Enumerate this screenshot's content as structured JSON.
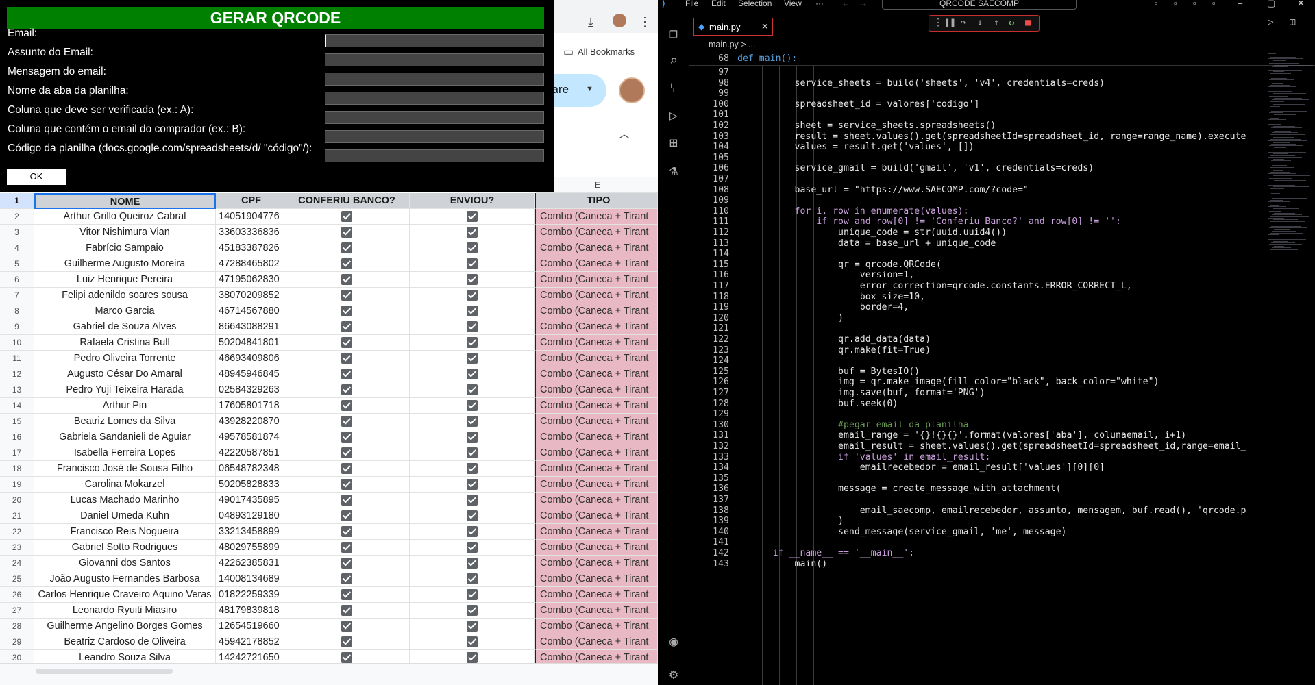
{
  "browser": {
    "bookmarks_label": "All Bookmarks",
    "share_label": "nare",
    "column_e_label": "E"
  },
  "dialog": {
    "title": "GERAR QRCODE",
    "fields": [
      {
        "label": "Email:",
        "value": ""
      },
      {
        "label": "Assunto do Email:",
        "value": ""
      },
      {
        "label": "Mensagem do email:",
        "value": ""
      },
      {
        "label": "Nome da aba da planilha:",
        "value": ""
      },
      {
        "label": "Coluna que deve ser verificada (ex.: A):",
        "value": ""
      },
      {
        "label": "Coluna que contém o email do comprador (ex.: B):",
        "value": ""
      },
      {
        "label": "Código da planilha (docs.google.com/spreadsheets/d/ \"código\"/):",
        "value": ""
      }
    ],
    "ok_label": "OK"
  },
  "sheet": {
    "headers": [
      "NOME",
      "CPF",
      "CONFERIU BANCO?",
      "ENVIOU?",
      "TIPO"
    ],
    "tipo_value": "Combo (Caneca + Tirant",
    "tipo_color": "#e8b9c4",
    "rows": [
      {
        "n": "2",
        "nome": "Arthur Grillo Queiroz Cabral",
        "cpf": "14051904776"
      },
      {
        "n": "3",
        "nome": "Vitor Nishimura Vian",
        "cpf": "33603336836"
      },
      {
        "n": "4",
        "nome": "Fabrício Sampaio",
        "cpf": "45183387826"
      },
      {
        "n": "5",
        "nome": "Guilherme Augusto Moreira",
        "cpf": "47288465802"
      },
      {
        "n": "6",
        "nome": "Luiz Henrique Pereira",
        "cpf": "47195062830"
      },
      {
        "n": "7",
        "nome": "Felipi adenildo soares sousa",
        "cpf": "38070209852"
      },
      {
        "n": "8",
        "nome": "Marco Garcia",
        "cpf": "46714567880"
      },
      {
        "n": "9",
        "nome": "Gabriel de Souza Alves",
        "cpf": "86643088291"
      },
      {
        "n": "10",
        "nome": "Rafaela Cristina Bull",
        "cpf": "50204841801"
      },
      {
        "n": "11",
        "nome": "Pedro Oliveira Torrente",
        "cpf": "46693409806"
      },
      {
        "n": "12",
        "nome": "Augusto César Do Amaral",
        "cpf": "48945946845"
      },
      {
        "n": "13",
        "nome": "Pedro Yuji Teixeira Harada",
        "cpf": "02584329263"
      },
      {
        "n": "14",
        "nome": "Arthur Pin",
        "cpf": "17605801718"
      },
      {
        "n": "15",
        "nome": "Beatriz Lomes da Silva",
        "cpf": "43928220870"
      },
      {
        "n": "16",
        "nome": "Gabriela Sandanieli de Aguiar",
        "cpf": "49578581874"
      },
      {
        "n": "17",
        "nome": "Isabella Ferreira Lopes",
        "cpf": "42220587851"
      },
      {
        "n": "18",
        "nome": "Francisco José de Sousa Filho",
        "cpf": "06548782348"
      },
      {
        "n": "19",
        "nome": "Carolina Mokarzel",
        "cpf": "50205828833"
      },
      {
        "n": "20",
        "nome": "Lucas Machado Marinho",
        "cpf": "49017435895"
      },
      {
        "n": "21",
        "nome": "Daniel Umeda Kuhn",
        "cpf": "04893129180"
      },
      {
        "n": "22",
        "nome": "Francisco Reis Nogueira",
        "cpf": "33213458899"
      },
      {
        "n": "23",
        "nome": "Gabriel Sotto Rodrigues",
        "cpf": "48029755899"
      },
      {
        "n": "24",
        "nome": "Giovanni dos Santos",
        "cpf": "42262385831"
      },
      {
        "n": "25",
        "nome": "João Augusto Fernandes Barbosa",
        "cpf": "14008134689"
      },
      {
        "n": "26",
        "nome": "Carlos Henrique Craveiro Aquino Veras",
        "cpf": "01822259339"
      },
      {
        "n": "27",
        "nome": "Leonardo Ryuiti Miasiro",
        "cpf": "48179839818"
      },
      {
        "n": "28",
        "nome": "Guilherme Angelino Borges Gomes",
        "cpf": "12654519660"
      },
      {
        "n": "29",
        "nome": "Beatriz Cardoso de Oliveira",
        "cpf": "45942178852"
      },
      {
        "n": "30",
        "nome": "Leandro Souza Silva",
        "cpf": "14242721650"
      }
    ]
  },
  "vscode": {
    "menu": [
      "File",
      "Edit",
      "Selection",
      "View",
      "···"
    ],
    "search_title": "QRCODE SAECOMP",
    "tab_label": "main.py",
    "tab_icon": "python-file-icon",
    "breadcrumb": "main.py > ...",
    "sticky": {
      "n": "68",
      "text": "def main():"
    },
    "lines": [
      {
        "n": "97",
        "text": ""
      },
      {
        "n": "98",
        "text": "        service_sheets = build('sheets', 'v4', credentials=creds)"
      },
      {
        "n": "99",
        "text": ""
      },
      {
        "n": "100",
        "text": "        spreadsheet_id = valores['codigo']"
      },
      {
        "n": "101",
        "text": ""
      },
      {
        "n": "102",
        "text": "        sheet = service_sheets.spreadsheets()"
      },
      {
        "n": "103",
        "text": "        result = sheet.values().get(spreadsheetId=spreadsheet_id, range=range_name).execute"
      },
      {
        "n": "104",
        "text": "        values = result.get('values', [])"
      },
      {
        "n": "105",
        "text": ""
      },
      {
        "n": "106",
        "text": "        service_gmail = build('gmail', 'v1', credentials=creds)"
      },
      {
        "n": "107",
        "text": ""
      },
      {
        "n": "108",
        "text": "        base_url = \"https://www.SAECOMP.com/?code=\""
      },
      {
        "n": "109",
        "text": ""
      },
      {
        "n": "110",
        "text": "        for i, row in enumerate(values):"
      },
      {
        "n": "111",
        "text": "            if row and row[0] != 'Conferiu Banco?' and row[0] != '':"
      },
      {
        "n": "112",
        "text": "                unique_code = str(uuid.uuid4())"
      },
      {
        "n": "113",
        "text": "                data = base_url + unique_code"
      },
      {
        "n": "114",
        "text": ""
      },
      {
        "n": "115",
        "text": "                qr = qrcode.QRCode("
      },
      {
        "n": "116",
        "text": "                    version=1,"
      },
      {
        "n": "117",
        "text": "                    error_correction=qrcode.constants.ERROR_CORRECT_L,"
      },
      {
        "n": "118",
        "text": "                    box_size=10,"
      },
      {
        "n": "119",
        "text": "                    border=4,"
      },
      {
        "n": "120",
        "text": "                )"
      },
      {
        "n": "121",
        "text": ""
      },
      {
        "n": "122",
        "text": "                qr.add_data(data)"
      },
      {
        "n": "123",
        "text": "                qr.make(fit=True)"
      },
      {
        "n": "124",
        "text": ""
      },
      {
        "n": "125",
        "text": "                buf = BytesIO()"
      },
      {
        "n": "126",
        "text": "                img = qr.make_image(fill_color=\"black\", back_color=\"white\")"
      },
      {
        "n": "127",
        "text": "                img.save(buf, format='PNG')"
      },
      {
        "n": "128",
        "text": "                buf.seek(0)"
      },
      {
        "n": "129",
        "text": ""
      },
      {
        "n": "130",
        "text": "                #pegar email da planilha"
      },
      {
        "n": "131",
        "text": "                email_range = '{}!{}{}'.format(valores['aba'], colunaemail, i+1)"
      },
      {
        "n": "132",
        "text": "                email_result = sheet.values().get(spreadsheetId=spreadsheet_id,range=email_"
      },
      {
        "n": "133",
        "text": "                if 'values' in email_result:"
      },
      {
        "n": "134",
        "text": "                    emailrecebedor = email_result['values'][0][0]"
      },
      {
        "n": "135",
        "text": ""
      },
      {
        "n": "136",
        "text": "                message = create_message_with_attachment("
      },
      {
        "n": "137",
        "text": ""
      },
      {
        "n": "138",
        "text": "                    email_saecomp, emailrecebedor, assunto, mensagem, buf.read(), 'qrcode.p"
      },
      {
        "n": "139",
        "text": "                )"
      },
      {
        "n": "140",
        "text": "                send_message(service_gmail, 'me', message)"
      },
      {
        "n": "141",
        "text": ""
      },
      {
        "n": "142",
        "text": "    if __name__ == '__main__':"
      },
      {
        "n": "143",
        "text": "        main()"
      }
    ]
  }
}
